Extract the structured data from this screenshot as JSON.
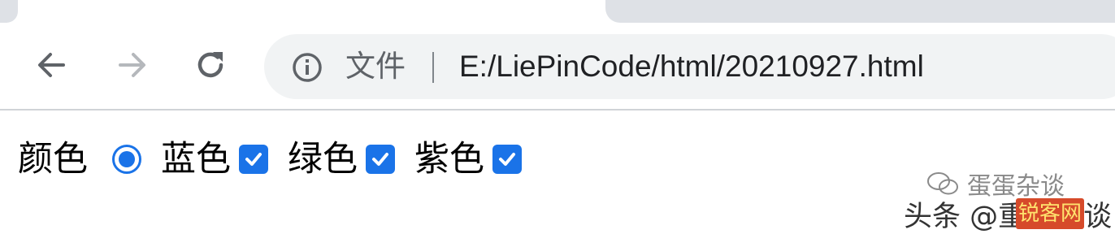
{
  "browser": {
    "nav": {
      "back_icon": "arrow-left-icon",
      "forward_icon": "arrow-right-icon",
      "reload_icon": "reload-icon"
    },
    "address_bar": {
      "info_icon": "info-icon",
      "scheme_label": "文件",
      "url": "E:/LiePinCode/html/20210927.html"
    },
    "colors": {
      "accent": "#1a73e8",
      "omnibox_bg": "#f1f3f4",
      "tab_bg": "#dee1e6"
    }
  },
  "page": {
    "form": {
      "label": "颜色",
      "radio_selected": true,
      "options": [
        {
          "label": "蓝色",
          "checked": true
        },
        {
          "label": "绿色",
          "checked": true
        },
        {
          "label": "紫色",
          "checked": true
        }
      ]
    }
  },
  "watermark": {
    "top_text": "蛋蛋杂谈",
    "bottom_text": "头条 @重三杂谈",
    "stamp_text": "锐客网"
  }
}
